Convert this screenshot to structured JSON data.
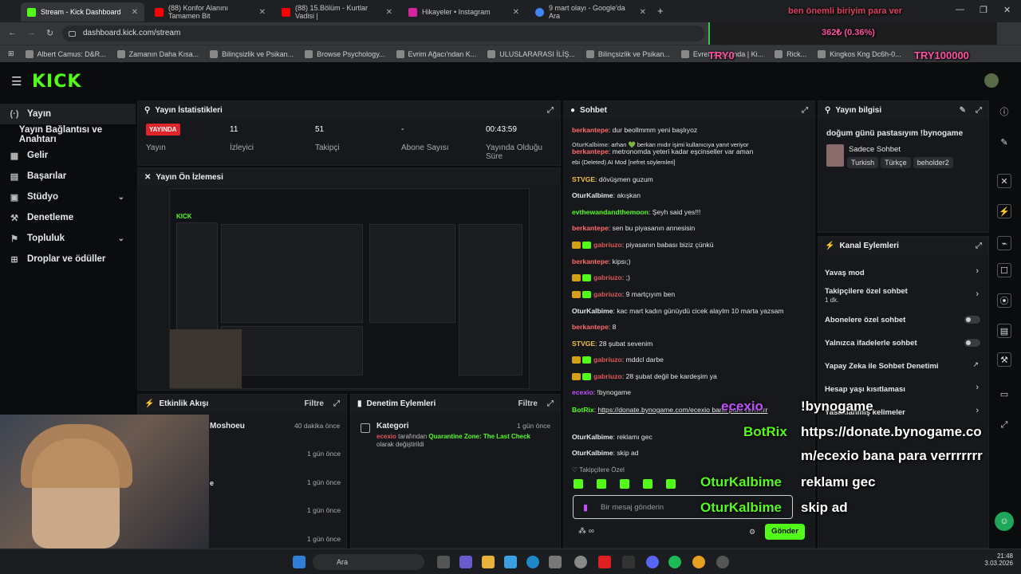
{
  "browser": {
    "tabs": [
      {
        "title": "Stream - Kick Dashboard",
        "color": "#53fc18",
        "active": true
      },
      {
        "title": "(88) Konfor Alanını Tamamen Bit",
        "color": "#ff0000"
      },
      {
        "title": "(88) 15.Bölüm - Kurtlar Vadisi |",
        "color": "#ff0000"
      },
      {
        "title": "Hikayeler • Instagram",
        "color": "#d6249f"
      },
      {
        "title": "9 mart olayı - Google'da Ara",
        "color": "#4285f4"
      }
    ],
    "url": "dashboard.kick.com/stream",
    "bookmarks": [
      "Albert Camus: D&R...",
      "Zamanın Daha Kısa...",
      "Bilinçsizlik ve Psikan...",
      "Browse Psychology...",
      "Evrim Ağacı'ndan K...",
      "ULUSLARARASI İLİŞ...",
      "Bilinçsizlik ve Psikan...",
      "Evren Avucunda | Ki...",
      "Rick...",
      "Kingkos Kng Dc6h-0..."
    ]
  },
  "overlay": {
    "top_text": "ben önemli biriyim para ver",
    "progress_text": "362₺ (0.36%)",
    "goal_left": "TRY0",
    "goal_right": "TRY100000"
  },
  "kick": {
    "logo": "KICK"
  },
  "sidebar": {
    "items": [
      {
        "label": "Yayın",
        "icon": "(·)",
        "active": true
      },
      {
        "label": "Yayın Bağlantısı ve Anahtarı",
        "icon": ""
      },
      {
        "label": "Gelir",
        "icon": "▦"
      },
      {
        "label": "Başarılar",
        "icon": "▤"
      },
      {
        "label": "Stüdyo",
        "icon": "▣",
        "chevron": true
      },
      {
        "label": "Denetleme",
        "icon": "⚒"
      },
      {
        "label": "Topluluk",
        "icon": "⚑",
        "chevron": true
      },
      {
        "label": "Droplar ve ödüller",
        "icon": "⊞"
      }
    ]
  },
  "stats": {
    "title": "Yayın İstatistikleri",
    "live_badge": "YAYINDA",
    "items": [
      {
        "value": "",
        "label": "Yayın"
      },
      {
        "value": "11",
        "label": "İzleyici"
      },
      {
        "value": "51",
        "label": "Takipçi"
      },
      {
        "value": "-",
        "label": "Abone Sayısı"
      },
      {
        "value": "00:43:59",
        "label": "Yayında Olduğu Süre"
      }
    ]
  },
  "preview": {
    "title": "Yayın Ön İzlemesi"
  },
  "activity": {
    "title": "Etkinlik Akışı",
    "filter": "Filtre",
    "rows": [
      {
        "name": "Moshoeu",
        "time": "40 dakika önce"
      },
      {
        "name": "",
        "time": "1 gün önce"
      },
      {
        "name": "",
        "time": "1 gün önce"
      },
      {
        "name": "e",
        "time": "1 gün önce"
      },
      {
        "name": "",
        "time": "1 gün önce"
      },
      {
        "name": "",
        "time": "1 gün önce"
      }
    ]
  },
  "moderation": {
    "title": "Denetim Eylemleri",
    "filter": "Filtre",
    "item_title": "Kategori",
    "item_time": "1 gün önce",
    "item_user": "ecexio",
    "item_mid": " tarafından ",
    "item_category": "Quarantine Zone: The Last Check",
    "item_end": "olarak değiştirildi"
  },
  "chat": {
    "title": "Sohbet",
    "lines": [
      {
        "user": "berkantepe",
        "color": "#ff6a6a",
        "text": "dur beollmmm yeni başlıyoz"
      },
      {
        "user": "OturKalbime",
        "color": "#aaaaaa",
        "text": "arhan 💚 berkan mıdır işimi kullanıcıya yanıt veriyor",
        "small": true
      },
      {
        "user": "berkantepe",
        "color": "#ff6a6a",
        "text": "metronomda yeteri kadar eşcinseller var aman"
      },
      {
        "user": "",
        "color": "#e6e6e6",
        "text": "ebi (Deleted) AI Mod [nefret söylemleri]",
        "small": true
      },
      {
        "user": "STVGE",
        "color": "#f0c040",
        "text": "dövüşmen guzum"
      },
      {
        "user": "OturKalbime",
        "color": "#e6e6e6",
        "text": "akışkan"
      },
      {
        "user": "evthewandandthemoon",
        "color": "#53fc18",
        "text": "Şeyh said yes!!!"
      },
      {
        "user": "berkantepe",
        "color": "#ff6a6a",
        "text": "sen bu piyasanın annesisin"
      },
      {
        "user": "gabriuzo",
        "color": "#e05858",
        "text": "piyasanın babası biziz çünkü",
        "badges": true
      },
      {
        "user": "berkantepe",
        "color": "#ff6a6a",
        "text": "kipsı;)"
      },
      {
        "user": "gabriuzo",
        "color": "#e05858",
        "text": ";)",
        "badges": true
      },
      {
        "user": "gabriuzo",
        "color": "#e05858",
        "text": "9 martçıyım ben",
        "badges": true
      },
      {
        "user": "OturKalbime",
        "color": "#e6e6e6",
        "text": "kac mart kadın günüydü cicek alaylm 10 marta yazsam"
      },
      {
        "user": "berkantepe",
        "color": "#ff6a6a",
        "text": "8"
      },
      {
        "user": "STVGE",
        "color": "#f0c040",
        "text": "28 şubat sevenim"
      },
      {
        "user": "gabriuzo",
        "color": "#e05858",
        "text": "mddcl darbe",
        "badges": true
      },
      {
        "user": "gabriuzo",
        "color": "#e05858",
        "text": "28 şubat değil be kardeşim ya",
        "badges": true
      },
      {
        "user": "ecexio",
        "color": "#c050ff",
        "text": "!bynogame"
      },
      {
        "user": "BotRix",
        "color": "#53fc18",
        "text": "https://donate.bynogame.com/ecexio bana para verrrrrrr"
      },
      {
        "user": "OturKalbime",
        "color": "#e6e6e6",
        "text": "reklamı gec"
      },
      {
        "user": "OturKalbime",
        "color": "#e6e6e6",
        "text": "skip ad"
      }
    ],
    "followers_only": "Takipçilere Özel",
    "input_placeholder": "Bir mesaj gönderin",
    "send_label": "Gönder"
  },
  "stream_info": {
    "title": "Yayın bilgisi",
    "stream_title": "doğum günü pastasıyım !bynogame",
    "category": "Sadece Sohbet",
    "tags": [
      "Turkish",
      "Türkçe",
      "beholder2"
    ]
  },
  "channel_actions": {
    "title": "Kanal Eylemleri",
    "items": [
      {
        "label": "Yavaş mod",
        "type": "arrow"
      },
      {
        "label": "Takipçilere özel sohbet",
        "sub": "1 dk.",
        "type": "arrow"
      },
      {
        "label": "Abonelere özel sohbet",
        "type": "toggle"
      },
      {
        "label": "Yalnızca ifadelerle sohbet",
        "type": "toggle"
      },
      {
        "label": "Yapay Zeka ile Sohbet Denetimi",
        "type": "ext"
      },
      {
        "label": "Hesap yaşı kısıtlaması",
        "type": "arrow"
      },
      {
        "label": "Yasaklanmış kelimeler",
        "type": "arrow"
      }
    ]
  },
  "chat_overlay": [
    {
      "user": "ecexio",
      "color": "#c050ff",
      "text": "!bynogame"
    },
    {
      "user": "BotRix",
      "color": "#53fc18",
      "text": "https://donate.bynogame.co"
    },
    {
      "user": "",
      "color": "#ffffff",
      "text": "m/ecexio bana para verrrrrrr"
    },
    {
      "user": "OturKalbime",
      "color": "#53fc18",
      "text": "reklamı gec"
    },
    {
      "user": "OturKalbime",
      "color": "#53fc18",
      "text": "skip ad"
    }
  ],
  "taskbar": {
    "search": "Ara",
    "time": "21:48",
    "date": "3.03.2026"
  }
}
